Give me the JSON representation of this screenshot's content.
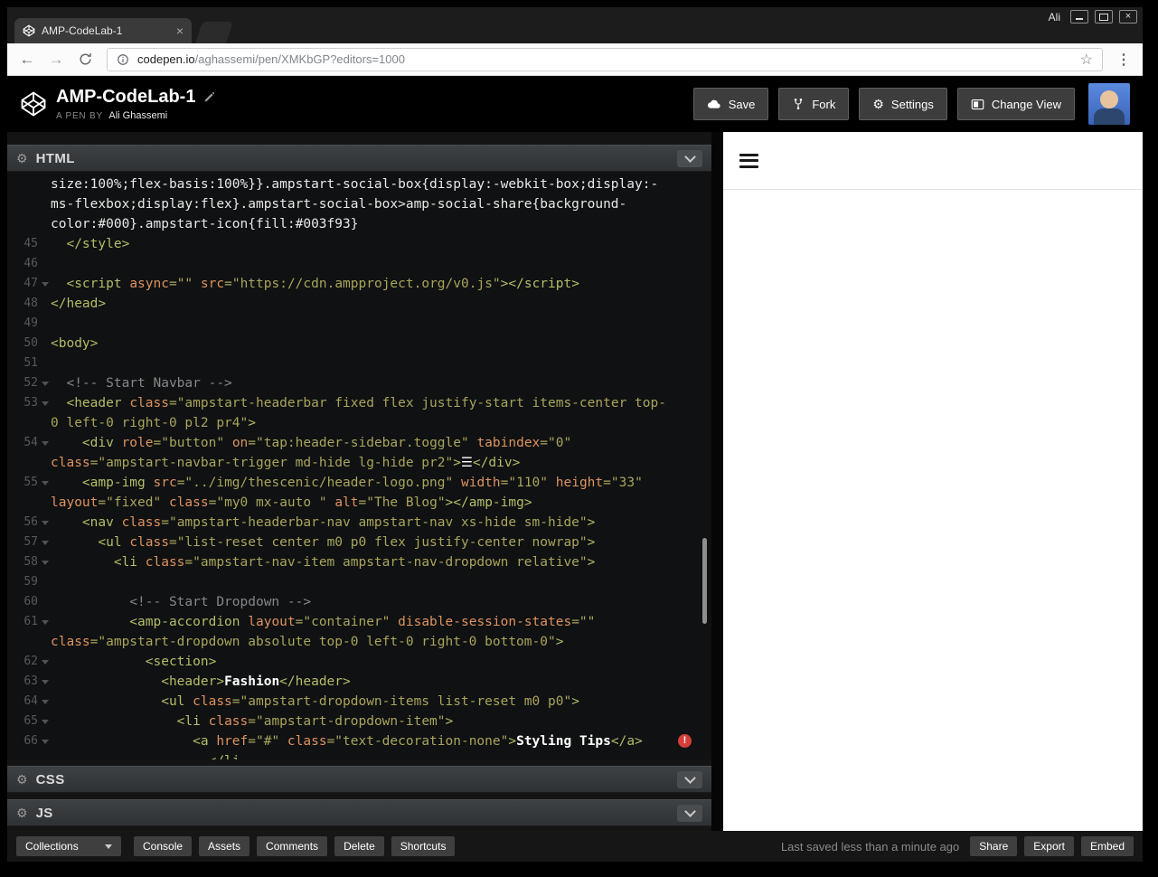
{
  "window": {
    "profile_name": "Ali"
  },
  "browser": {
    "tab_title": "AMP-CodeLab-1",
    "tab_close": "×",
    "url_domain": "codepen.io",
    "url_path": "/aghassemi/pen/XMKbGP?editors=1000",
    "star_glyph": "☆",
    "back_glyph": "←",
    "forward_glyph": "→",
    "menu_glyph": "⋮"
  },
  "header": {
    "title": "AMP-CodeLab-1",
    "byline_label": "A PEN BY",
    "author": "Ali Ghassemi",
    "buttons": {
      "save": "Save",
      "fork": "Fork",
      "settings": "Settings",
      "change_view": "Change View"
    },
    "settings_gear_glyph": "⚙"
  },
  "panes": {
    "html": "HTML",
    "css": "CSS",
    "js": "JS",
    "gear_glyph": "⚙"
  },
  "editor": {
    "error_glyph": "!",
    "rows": [
      {
        "n": "",
        "seg": [
          [
            "plain",
            "size:100%;flex-basis:100%}}.ampstart-social-box{display:-webkit-box;display:-"
          ]
        ]
      },
      {
        "n": "",
        "seg": [
          [
            "plain",
            "ms-flexbox;display:flex}.ampstart-social-box>amp-social-share{background-"
          ]
        ]
      },
      {
        "n": "",
        "seg": [
          [
            "plain",
            "color:#000}.ampstart-icon{fill:#003f93}"
          ]
        ]
      },
      {
        "n": "45",
        "seg": [
          [
            "tag",
            "  </style>"
          ]
        ]
      },
      {
        "n": "46",
        "seg": []
      },
      {
        "n": "47",
        "f": true,
        "seg": [
          [
            "tag",
            "  <script "
          ],
          [
            "attr",
            "async"
          ],
          [
            "str",
            "=\"\""
          ],
          [
            "plain",
            " "
          ],
          [
            "attr",
            "src"
          ],
          [
            "str",
            "=\"https://cdn.ampproject.org/v0.js\""
          ],
          [
            "tag",
            "></script>"
          ]
        ]
      },
      {
        "n": "48",
        "seg": [
          [
            "tag",
            "</head>"
          ]
        ]
      },
      {
        "n": "49",
        "seg": []
      },
      {
        "n": "50",
        "seg": [
          [
            "tag",
            "<body>"
          ]
        ]
      },
      {
        "n": "51",
        "seg": []
      },
      {
        "n": "52",
        "f": true,
        "seg": [
          [
            "com",
            "  <!-- Start Navbar -->"
          ]
        ]
      },
      {
        "n": "53",
        "f": true,
        "seg": [
          [
            "tag",
            "  <header "
          ],
          [
            "attr",
            "class"
          ],
          [
            "str",
            "=\"ampstart-headerbar fixed flex justify-start items-center top-"
          ]
        ]
      },
      {
        "n": "",
        "seg": [
          [
            "str",
            "0 left-0 right-0 pl2 pr4\""
          ],
          [
            "tag",
            ">"
          ]
        ]
      },
      {
        "n": "54",
        "f": true,
        "seg": [
          [
            "tag",
            "    <div "
          ],
          [
            "attr",
            "role"
          ],
          [
            "str",
            "=\"button\""
          ],
          [
            "plain",
            " "
          ],
          [
            "attr",
            "on"
          ],
          [
            "str",
            "=\"tap:header-sidebar.toggle\""
          ],
          [
            "plain",
            " "
          ],
          [
            "attr",
            "tabindex"
          ],
          [
            "str",
            "=\"0\""
          ]
        ]
      },
      {
        "n": "",
        "seg": [
          [
            "attr",
            "class"
          ],
          [
            "str",
            "=\"ampstart-navbar-trigger md-hide lg-hide pr2\""
          ],
          [
            "tag",
            ">"
          ],
          [
            "txt",
            "☰"
          ],
          [
            "tag",
            "</div>"
          ]
        ]
      },
      {
        "n": "55",
        "f": true,
        "seg": [
          [
            "tag",
            "    <amp-img "
          ],
          [
            "attr",
            "src"
          ],
          [
            "str",
            "=\"../img/thescenic/header-logo.png\""
          ],
          [
            "plain",
            " "
          ],
          [
            "attr",
            "width"
          ],
          [
            "str",
            "=\"110\""
          ],
          [
            "plain",
            " "
          ],
          [
            "attr",
            "height"
          ],
          [
            "str",
            "=\"33\""
          ]
        ]
      },
      {
        "n": "",
        "seg": [
          [
            "attr",
            "layout"
          ],
          [
            "str",
            "=\"fixed\""
          ],
          [
            "plain",
            " "
          ],
          [
            "attr",
            "class"
          ],
          [
            "str",
            "=\"my0 mx-auto \""
          ],
          [
            "plain",
            " "
          ],
          [
            "attr",
            "alt"
          ],
          [
            "str",
            "=\"The Blog\""
          ],
          [
            "tag",
            "></amp-img>"
          ]
        ]
      },
      {
        "n": "56",
        "f": true,
        "seg": [
          [
            "tag",
            "    <nav "
          ],
          [
            "attr",
            "class"
          ],
          [
            "str",
            "=\"ampstart-headerbar-nav ampstart-nav xs-hide sm-hide\""
          ],
          [
            "tag",
            ">"
          ]
        ]
      },
      {
        "n": "57",
        "f": true,
        "seg": [
          [
            "tag",
            "      <ul "
          ],
          [
            "attr",
            "class"
          ],
          [
            "str",
            "=\"list-reset center m0 p0 flex justify-center nowrap\""
          ],
          [
            "tag",
            ">"
          ]
        ]
      },
      {
        "n": "58",
        "f": true,
        "seg": [
          [
            "tag",
            "        <li "
          ],
          [
            "attr",
            "class"
          ],
          [
            "str",
            "=\"ampstart-nav-item ampstart-nav-dropdown relative\""
          ],
          [
            "tag",
            ">"
          ]
        ]
      },
      {
        "n": "59",
        "seg": []
      },
      {
        "n": "60",
        "seg": [
          [
            "com",
            "          <!-- Start Dropdown -->"
          ]
        ]
      },
      {
        "n": "61",
        "f": true,
        "seg": [
          [
            "tag",
            "          <amp-accordion "
          ],
          [
            "attr",
            "layout"
          ],
          [
            "str",
            "=\"container\""
          ],
          [
            "plain",
            " "
          ],
          [
            "attr",
            "disable-session-states"
          ],
          [
            "str",
            "=\"\""
          ]
        ]
      },
      {
        "n": "",
        "seg": [
          [
            "attr",
            "class"
          ],
          [
            "str",
            "=\"ampstart-dropdown absolute top-0 left-0 right-0 bottom-0\""
          ],
          [
            "tag",
            ">"
          ]
        ]
      },
      {
        "n": "62",
        "f": true,
        "seg": [
          [
            "tag",
            "            <section>"
          ]
        ]
      },
      {
        "n": "63",
        "f": true,
        "seg": [
          [
            "tag",
            "              <header>"
          ],
          [
            "txt",
            "Fashion"
          ],
          [
            "tag",
            "</header>"
          ]
        ]
      },
      {
        "n": "64",
        "f": true,
        "seg": [
          [
            "tag",
            "              <ul "
          ],
          [
            "attr",
            "class"
          ],
          [
            "str",
            "=\"ampstart-dropdown-items list-reset m0 p0\""
          ],
          [
            "tag",
            ">"
          ]
        ]
      },
      {
        "n": "65",
        "f": true,
        "seg": [
          [
            "tag",
            "                <li "
          ],
          [
            "attr",
            "class"
          ],
          [
            "str",
            "=\"ampstart-dropdown-item\""
          ],
          [
            "tag",
            ">"
          ]
        ]
      },
      {
        "n": "66",
        "f": true,
        "err": true,
        "seg": [
          [
            "tag",
            "                  <a "
          ],
          [
            "attr",
            "href"
          ],
          [
            "str",
            "=\"#\""
          ],
          [
            "plain",
            " "
          ],
          [
            "attr",
            "class"
          ],
          [
            "str",
            "=\"text-decoration-none\""
          ],
          [
            "tag",
            ">"
          ],
          [
            "txt",
            "Styling Tips"
          ],
          [
            "tag",
            "</a>"
          ]
        ]
      },
      {
        "n": "",
        "seg": [
          [
            "tag",
            "                    </li"
          ]
        ]
      }
    ]
  },
  "footer": {
    "collections_label": "Collections",
    "buttons": [
      "Console",
      "Assets",
      "Comments",
      "Delete",
      "Shortcuts"
    ],
    "status": "Last saved less than a minute ago",
    "right_buttons": [
      "Share",
      "Export",
      "Embed"
    ]
  },
  "colors": {
    "error_red": "#d43f3a",
    "code_tag": "#b5bd68",
    "code_attr": "#de935f",
    "code_string": "#a9a55c",
    "amp_icon_fill": "#003f93"
  }
}
